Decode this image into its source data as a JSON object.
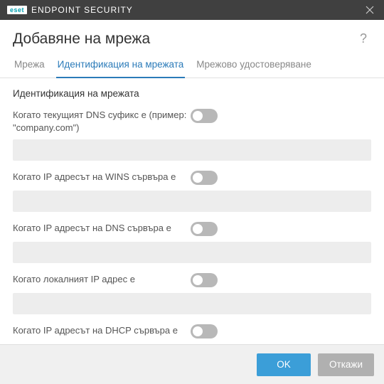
{
  "titlebar": {
    "brand_badge": "eset",
    "product_name": "ENDPOINT SECURITY"
  },
  "header": {
    "title": "Добавяне на мрежа",
    "help_tooltip": "?"
  },
  "tabs": [
    {
      "label": "Мрежа",
      "active": false
    },
    {
      "label": "Идентификация на мрежата",
      "active": true
    },
    {
      "label": "Мрежово удостоверяване",
      "active": false
    }
  ],
  "section": {
    "title": "Идентификация на мрежата",
    "fields": [
      {
        "label": "Когато текущият DNS суфикс е (пример: \"company.com\")",
        "toggle": false,
        "value": ""
      },
      {
        "label": "Когато IP адресът на WINS сървъра е",
        "toggle": false,
        "value": ""
      },
      {
        "label": "Когато IP адресът на DNS сървъра е",
        "toggle": false,
        "value": ""
      },
      {
        "label": "Когато локалният IP адрес е",
        "toggle": false,
        "value": ""
      },
      {
        "label": "Когато IP адресът на DHCP сървъра е",
        "toggle": false,
        "value": ""
      }
    ]
  },
  "footer": {
    "ok_label": "OK",
    "cancel_label": "Откажи"
  }
}
